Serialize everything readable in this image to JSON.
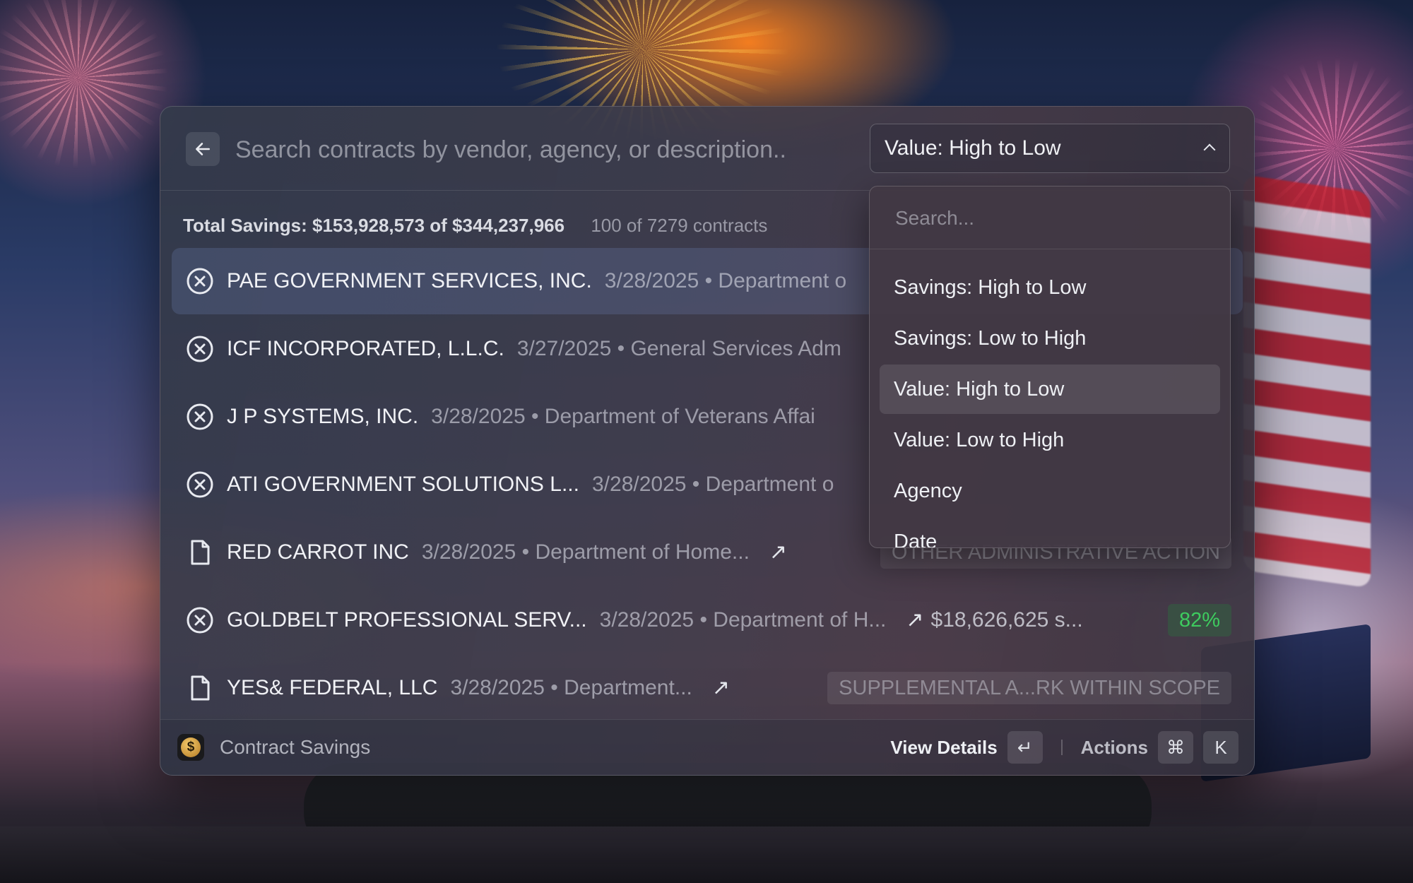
{
  "search": {
    "placeholder": "Search contracts by vendor, agency, or description..",
    "value": ""
  },
  "sort": {
    "selected": "Value: High to Low",
    "search_placeholder": "Search...",
    "options": [
      "Savings: High to Low",
      "Savings: Low to High",
      "Value: High to Low",
      "Value: Low to High",
      "Agency",
      "Date"
    ]
  },
  "summary": {
    "total": "Total Savings: $153,928,573 of $344,237,966",
    "count": "100 of 7279 contracts"
  },
  "rows": [
    {
      "icon": "cancel-circle-icon",
      "vendor": "PAE GOVERNMENT SERVICES, INC.",
      "meta": "3/28/2025 • Department o",
      "selected": true
    },
    {
      "icon": "cancel-circle-icon",
      "vendor": "ICF INCORPORATED, L.L.C.",
      "meta": "3/27/2025 • General Services Adm"
    },
    {
      "icon": "cancel-circle-icon",
      "vendor": "J P SYSTEMS, INC.",
      "meta": "3/28/2025 • Department of Veterans Affai"
    },
    {
      "icon": "cancel-circle-icon",
      "vendor": "ATI GOVERNMENT SOLUTIONS L...",
      "meta": "3/28/2025 • Department o"
    },
    {
      "icon": "document-icon",
      "vendor": "RED CARROT INC",
      "meta": "3/28/2025 • Department of Home...",
      "ext": "↗",
      "tag": "OTHER ADMINISTRATIVE ACTION"
    },
    {
      "icon": "cancel-circle-icon",
      "vendor": "GOLDBELT PROFESSIONAL SERV...",
      "meta": "3/28/2025 • Department of H...",
      "ext": "↗",
      "amount": "$18,626,625 s...",
      "tag": "82%"
    },
    {
      "icon": "document-icon",
      "vendor": "YES& FEDERAL, LLC",
      "meta": "3/28/2025 • Department...",
      "ext": "↗",
      "tag": "SUPPLEMENTAL A...RK WITHIN SCOPE"
    }
  ],
  "footer": {
    "app_name": "Contract Savings",
    "app_logo_glyph": "$",
    "primary_action": "View Details",
    "primary_key": "↵",
    "secondary_action": "Actions",
    "secondary_keys": [
      "⌘",
      "K"
    ]
  },
  "colors": {
    "savings_green": "#3ecb5f",
    "selected_row": "#5a6a9a"
  }
}
